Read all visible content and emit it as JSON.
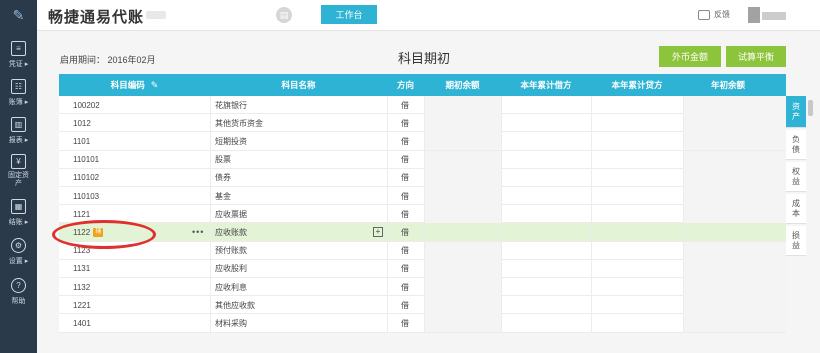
{
  "app": {
    "title": "畅捷通易代账",
    "workbench_label": "工作台",
    "feedback_label": "反馈"
  },
  "sidebar": {
    "items": [
      {
        "label": "凭证",
        "icon": "voucher-icon"
      },
      {
        "label": "账簿",
        "icon": "ledger-icon"
      },
      {
        "label": "报表",
        "icon": "report-icon"
      },
      {
        "label": "固定资产",
        "icon": "fixed-asset-icon"
      },
      {
        "label": "结账",
        "icon": "closing-icon"
      },
      {
        "label": "设置",
        "icon": "gear-icon"
      },
      {
        "label": "帮助",
        "icon": "help-icon"
      }
    ]
  },
  "header": {
    "period_label": "启用期间：",
    "period_value": "2016年02月",
    "page_title": "科目期初",
    "foreign_currency_button": "外币金额",
    "trial_balance_button": "试算平衡"
  },
  "table": {
    "columns": [
      "科目编码",
      "科目名称",
      "方向",
      "期初余额",
      "本年累计借方",
      "本年累计贷方",
      "年初余额"
    ],
    "rows": [
      {
        "code": "100202",
        "name": "花旗银行",
        "direction": "借"
      },
      {
        "code": "1012",
        "name": "其他货币资金",
        "direction": "借"
      },
      {
        "code": "1101",
        "name": "短期投资",
        "direction": "借"
      },
      {
        "code": "110101",
        "name": "股票",
        "direction": "借"
      },
      {
        "code": "110102",
        "name": "债券",
        "direction": "借"
      },
      {
        "code": "110103",
        "name": "基金",
        "direction": "借"
      },
      {
        "code": "1121",
        "name": "应收票据",
        "direction": "借"
      },
      {
        "code": "1122",
        "name": "应收账款",
        "direction": "借",
        "badge": "辅",
        "highlighted": true
      },
      {
        "code": "1123",
        "name": "预付账款",
        "direction": "借"
      },
      {
        "code": "1131",
        "name": "应收股利",
        "direction": "借"
      },
      {
        "code": "1132",
        "name": "应收利息",
        "direction": "借"
      },
      {
        "code": "1221",
        "name": "其他应收款",
        "direction": "借"
      },
      {
        "code": "1401",
        "name": "材料采购",
        "direction": "借"
      }
    ]
  },
  "category_tabs": [
    {
      "label": "资产",
      "active": true
    },
    {
      "label": "负债"
    },
    {
      "label": "权益"
    },
    {
      "label": "成本"
    },
    {
      "label": "损益"
    }
  ],
  "colors": {
    "accent": "#2fb3d4",
    "sidebar": "#2b3a4a",
    "green_button": "#8cc43c",
    "highlight_row": "#e3f3d6",
    "annotation": "#e0302e"
  }
}
